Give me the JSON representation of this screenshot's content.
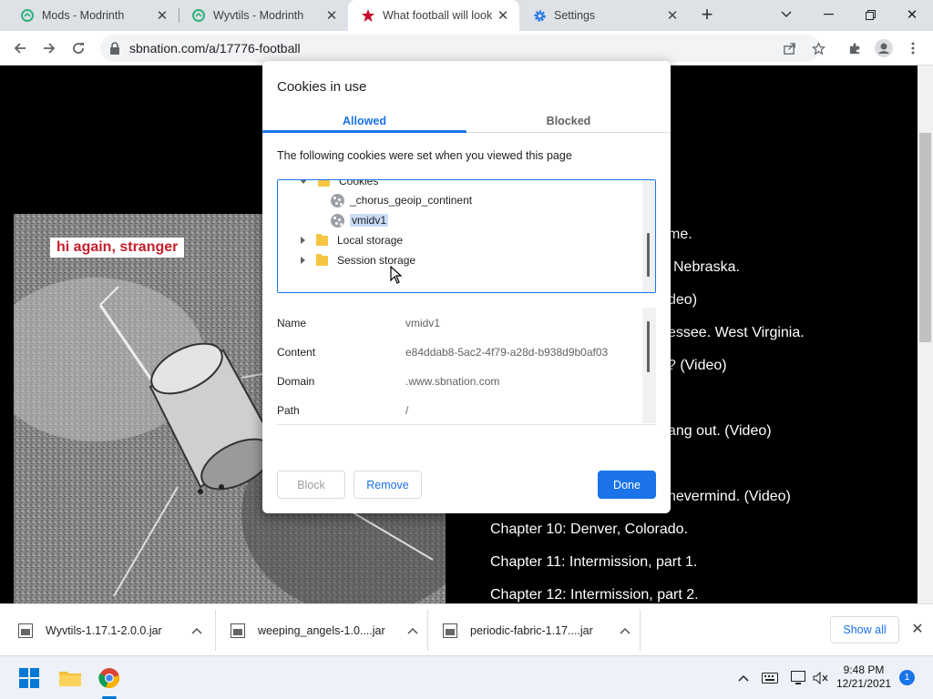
{
  "browser": {
    "tabs": [
      {
        "title": "Mods - Modrinth",
        "icon": "modrinth-icon"
      },
      {
        "title": "Wyvtils - Modrinth",
        "icon": "modrinth-icon"
      },
      {
        "title": "What football will look",
        "icon": "sbnation-star-icon"
      },
      {
        "title": "Settings",
        "icon": "gear-icon"
      }
    ],
    "url": "sbnation.com/a/17776-football"
  },
  "page": {
    "caption": "hi again, stranger",
    "chapters": [
      "me.",
      "Nebraska.",
      "deo)",
      "essee. West Virginia.",
      "? (Video)",
      "ang out. (Video)",
      "nevermind. (Video)",
      "Chapter 10: Denver, Colorado.",
      "Chapter 11: Intermission, part 1.",
      "Chapter 12: Intermission, part 2."
    ]
  },
  "dialog": {
    "title": "Cookies in use",
    "tab_allowed": "Allowed",
    "tab_blocked": "Blocked",
    "description": "The following cookies were set when you viewed this page",
    "tree": {
      "cookies_folder": "Cookies",
      "cookie_1": "_chorus_geoip_continent",
      "cookie_2": "vmidv1",
      "local_storage": "Local storage",
      "session_storage": "Session storage"
    },
    "details": [
      {
        "key": "Name",
        "value": "vmidv1"
      },
      {
        "key": "Content",
        "value": "e84ddab8-5ac2-4f79-a28d-b938d9b0af03"
      },
      {
        "key": "Domain",
        "value": ".www.sbnation.com"
      },
      {
        "key": "Path",
        "value": "/"
      }
    ],
    "block_label": "Block",
    "remove_label": "Remove",
    "done_label": "Done"
  },
  "downloads": {
    "items": [
      "Wyvtils-1.17.1-2.0.0.jar",
      "weeping_angels-1.0....jar",
      "periodic-fabric-1.17....jar"
    ],
    "show_all": "Show all"
  },
  "taskbar": {
    "time": "9:48 PM",
    "date": "12/21/2021",
    "notification_count": "1"
  },
  "colors": {
    "accent": "#1a73e8",
    "caption_red": "#c5202a"
  }
}
